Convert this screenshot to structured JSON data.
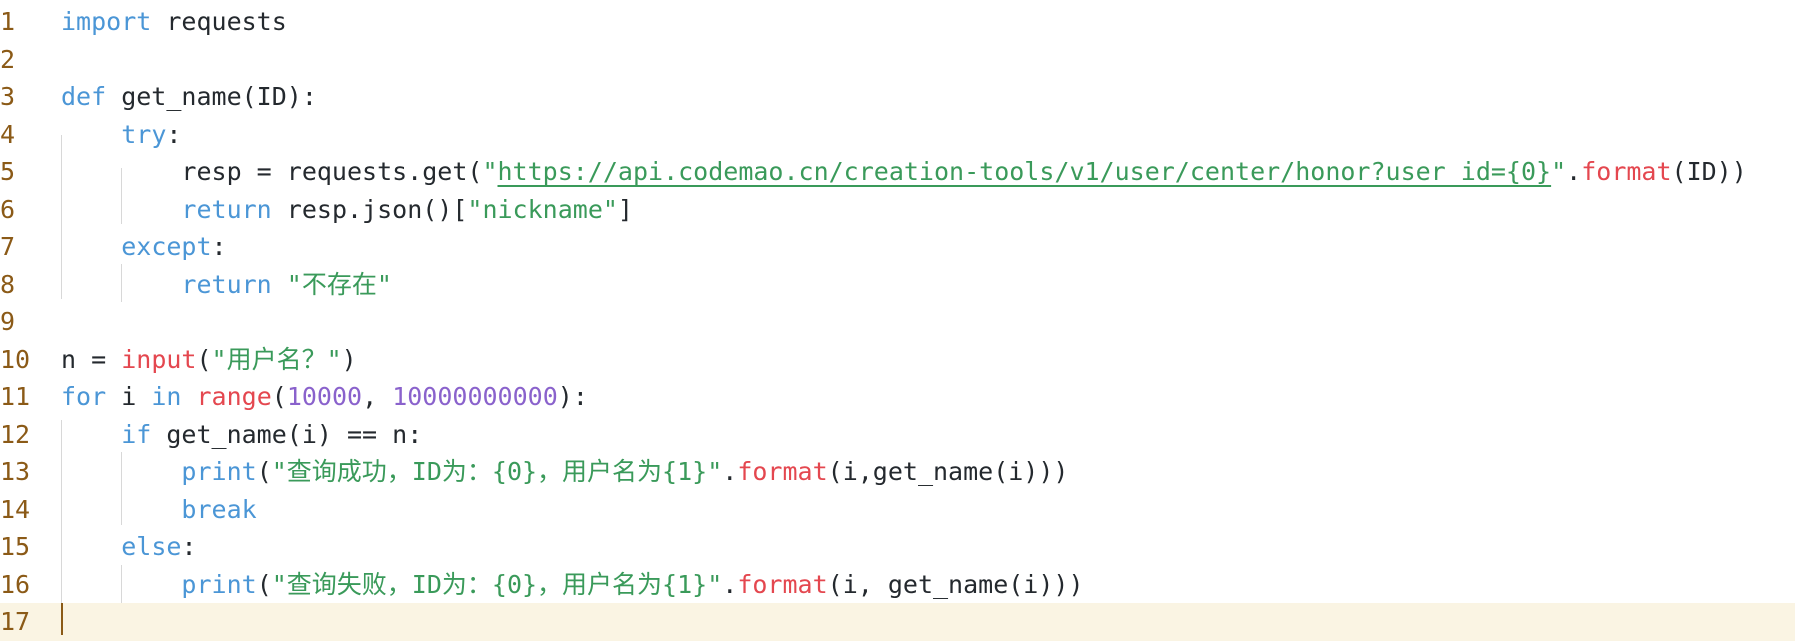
{
  "editor": {
    "language": "python",
    "colors": {
      "background": "#ffffff",
      "line_number": "#8b5a17",
      "keyword": "#4b96d6",
      "builtin_call": "#e4474f",
      "number": "#8a62cc",
      "string": "#3a9a5a",
      "current_line": "#faf4e3"
    },
    "lines": [
      {
        "num": "1",
        "tokens": [
          {
            "t": "kw",
            "v": "import"
          },
          {
            "t": "p",
            "v": " requests"
          }
        ]
      },
      {
        "num": "2",
        "tokens": []
      },
      {
        "num": "3",
        "tokens": [
          {
            "t": "kw",
            "v": "def"
          },
          {
            "t": "p",
            "v": " get_name(ID):"
          }
        ]
      },
      {
        "num": "4",
        "tokens": [
          {
            "t": "p",
            "v": "    "
          },
          {
            "t": "kw",
            "v": "try"
          },
          {
            "t": "p",
            "v": ":"
          }
        ]
      },
      {
        "num": "5",
        "tokens": [
          {
            "t": "p",
            "v": "        resp = requests.get("
          },
          {
            "t": "str",
            "v": "\""
          },
          {
            "t": "url",
            "v": "https://api.codemao.cn/creation-tools/v1/user/center/honor?user_id={0}"
          },
          {
            "t": "str",
            "v": "\""
          },
          {
            "t": "p",
            "v": "."
          },
          {
            "t": "fn",
            "v": "format"
          },
          {
            "t": "p",
            "v": "(ID))"
          }
        ]
      },
      {
        "num": "6",
        "tokens": [
          {
            "t": "p",
            "v": "        "
          },
          {
            "t": "kw",
            "v": "return"
          },
          {
            "t": "p",
            "v": " resp.json()["
          },
          {
            "t": "str",
            "v": "\"nickname\""
          },
          {
            "t": "p",
            "v": "]"
          }
        ]
      },
      {
        "num": "7",
        "tokens": [
          {
            "t": "p",
            "v": "    "
          },
          {
            "t": "kw",
            "v": "except"
          },
          {
            "t": "p",
            "v": ":"
          }
        ]
      },
      {
        "num": "8",
        "tokens": [
          {
            "t": "p",
            "v": "        "
          },
          {
            "t": "kw",
            "v": "return"
          },
          {
            "t": "p",
            "v": " "
          },
          {
            "t": "str",
            "v": "\"不存在\""
          }
        ]
      },
      {
        "num": "9",
        "tokens": []
      },
      {
        "num": "10",
        "tokens": [
          {
            "t": "p",
            "v": "n = "
          },
          {
            "t": "fn",
            "v": "input"
          },
          {
            "t": "p",
            "v": "("
          },
          {
            "t": "str",
            "v": "\"用户名？\""
          },
          {
            "t": "p",
            "v": ")"
          }
        ]
      },
      {
        "num": "11",
        "tokens": [
          {
            "t": "kw",
            "v": "for"
          },
          {
            "t": "p",
            "v": " i "
          },
          {
            "t": "kw",
            "v": "in"
          },
          {
            "t": "p",
            "v": " "
          },
          {
            "t": "fn",
            "v": "range"
          },
          {
            "t": "p",
            "v": "("
          },
          {
            "t": "num",
            "v": "10000"
          },
          {
            "t": "p",
            "v": ", "
          },
          {
            "t": "num",
            "v": "10000000000"
          },
          {
            "t": "p",
            "v": "):"
          }
        ]
      },
      {
        "num": "12",
        "tokens": [
          {
            "t": "p",
            "v": "    "
          },
          {
            "t": "kw",
            "v": "if"
          },
          {
            "t": "p",
            "v": " get_name(i) == n:"
          }
        ]
      },
      {
        "num": "13",
        "tokens": [
          {
            "t": "p",
            "v": "        "
          },
          {
            "t": "kw",
            "v": "print"
          },
          {
            "t": "p",
            "v": "("
          },
          {
            "t": "str",
            "v": "\"查询成功，ID为：{0}，用户名为{1}\""
          },
          {
            "t": "p",
            "v": "."
          },
          {
            "t": "fn",
            "v": "format"
          },
          {
            "t": "p",
            "v": "(i,get_name(i)))"
          }
        ]
      },
      {
        "num": "14",
        "tokens": [
          {
            "t": "p",
            "v": "        "
          },
          {
            "t": "kw",
            "v": "break"
          }
        ]
      },
      {
        "num": "15",
        "tokens": [
          {
            "t": "p",
            "v": "    "
          },
          {
            "t": "kw",
            "v": "else"
          },
          {
            "t": "p",
            "v": ":"
          }
        ]
      },
      {
        "num": "16",
        "tokens": [
          {
            "t": "p",
            "v": "        "
          },
          {
            "t": "kw",
            "v": "print"
          },
          {
            "t": "p",
            "v": "("
          },
          {
            "t": "str",
            "v": "\"查询失败，ID为：{0}，用户名为{1}\""
          },
          {
            "t": "p",
            "v": "."
          },
          {
            "t": "fn",
            "v": "format"
          },
          {
            "t": "p",
            "v": "(i, get_name(i)))"
          }
        ]
      },
      {
        "num": "17",
        "tokens": [],
        "current": true
      }
    ]
  }
}
